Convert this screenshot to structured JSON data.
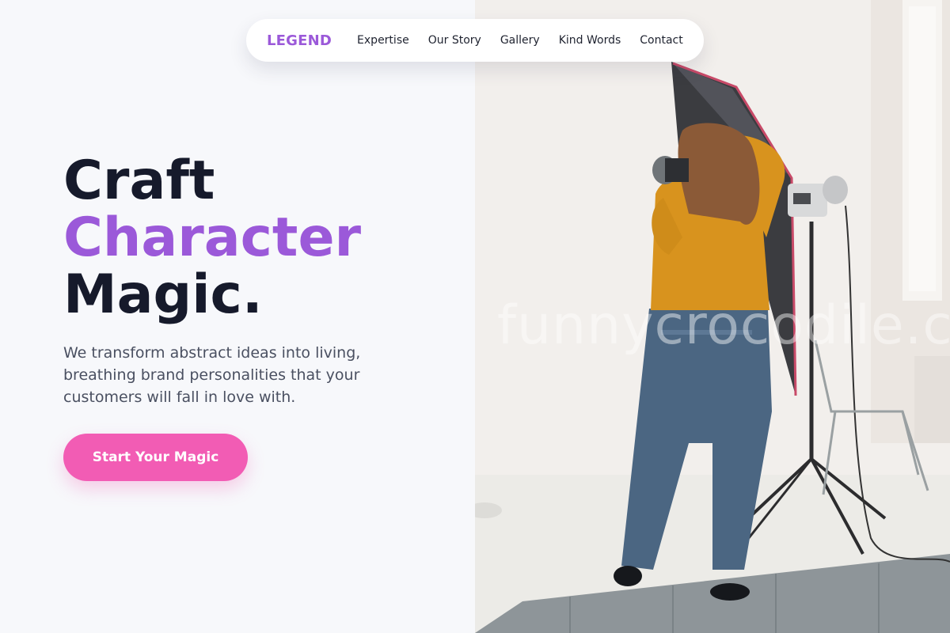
{
  "nav": {
    "logo": "LEGEND",
    "links": [
      "Expertise",
      "Our Story",
      "Gallery",
      "Kind Words",
      "Contact"
    ]
  },
  "hero": {
    "title_line1": "Craft",
    "title_line2": "Character",
    "title_line3": "Magic.",
    "description": "We transform abstract ideas into living, breathing brand personalities that your customers will fall in love with.",
    "cta_label": "Start Your Magic"
  },
  "photo": {
    "watermark": "funnycrocodile.com",
    "subject": "photographer-in-studio"
  },
  "colors": {
    "accent_purple": "#9b59d9",
    "cta_pink": "#f25cb4",
    "heading_dark": "#161a2b",
    "background": "#f7f8fb"
  }
}
